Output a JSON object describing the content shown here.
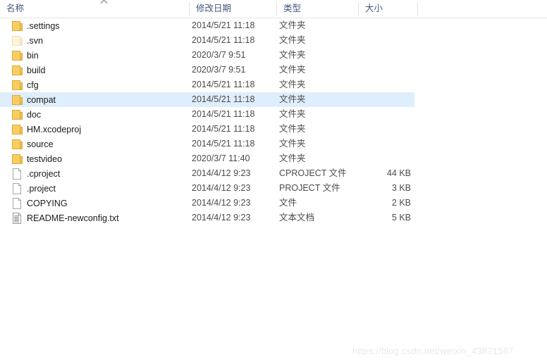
{
  "header": {
    "columns": [
      {
        "label": "名称",
        "sorted": true,
        "sort_direction": "ascending"
      },
      {
        "label": "修改日期",
        "sorted": false,
        "sort_direction": ""
      },
      {
        "label": "类型",
        "sorted": false,
        "sort_direction": ""
      },
      {
        "label": "大小",
        "sorted": false,
        "sort_direction": ""
      }
    ],
    "sort_arrow_glyph": "^"
  },
  "rows": [
    {
      "name": ".settings",
      "date": "2014/5/21 11:18",
      "type": "文件夹",
      "size": "",
      "icon": "folder-icon",
      "selected": false
    },
    {
      "name": ".svn",
      "date": "2014/5/21 11:18",
      "type": "文件夹",
      "size": "",
      "icon": "folder-hidden-icon",
      "selected": false
    },
    {
      "name": "bin",
      "date": "2020/3/7 9:51",
      "type": "文件夹",
      "size": "",
      "icon": "folder-icon",
      "selected": false
    },
    {
      "name": "build",
      "date": "2020/3/7 9:51",
      "type": "文件夹",
      "size": "",
      "icon": "folder-icon",
      "selected": false
    },
    {
      "name": "cfg",
      "date": "2014/5/21 11:18",
      "type": "文件夹",
      "size": "",
      "icon": "folder-icon",
      "selected": false
    },
    {
      "name": "compat",
      "date": "2014/5/21 11:18",
      "type": "文件夹",
      "size": "",
      "icon": "folder-icon",
      "selected": true
    },
    {
      "name": "doc",
      "date": "2014/5/21 11:18",
      "type": "文件夹",
      "size": "",
      "icon": "folder-icon",
      "selected": false
    },
    {
      "name": "HM.xcodeproj",
      "date": "2014/5/21 11:18",
      "type": "文件夹",
      "size": "",
      "icon": "folder-icon",
      "selected": false
    },
    {
      "name": "source",
      "date": "2014/5/21 11:18",
      "type": "文件夹",
      "size": "",
      "icon": "folder-icon",
      "selected": false
    },
    {
      "name": "testvideo",
      "date": "2020/3/7 11:40",
      "type": "文件夹",
      "size": "",
      "icon": "folder-icon",
      "selected": false
    },
    {
      "name": ".cproject",
      "date": "2014/4/12 9:23",
      "type": "CPROJECT 文件",
      "size": "44 KB",
      "icon": "file-icon",
      "selected": false
    },
    {
      "name": ".project",
      "date": "2014/4/12 9:23",
      "type": "PROJECT 文件",
      "size": "3 KB",
      "icon": "file-icon",
      "selected": false
    },
    {
      "name": "COPYING",
      "date": "2014/4/12 9:23",
      "type": "文件",
      "size": "2 KB",
      "icon": "file-icon",
      "selected": false
    },
    {
      "name": "README-newconfig.txt",
      "date": "2014/4/12 9:23",
      "type": "文本文档",
      "size": "5 KB",
      "icon": "text-file-icon",
      "selected": false
    }
  ],
  "watermark": {
    "text": "https://blog.csdn.net/weixin_43871567"
  },
  "colors": {
    "selection": "#dfeefc",
    "header_text": "#41577a",
    "folder": "#f5c453",
    "folder_hidden": "#fbeec8",
    "body_text": "#1b1b1b",
    "meta_text": "#4b4b4b",
    "watermark": "#e9e9e9"
  }
}
